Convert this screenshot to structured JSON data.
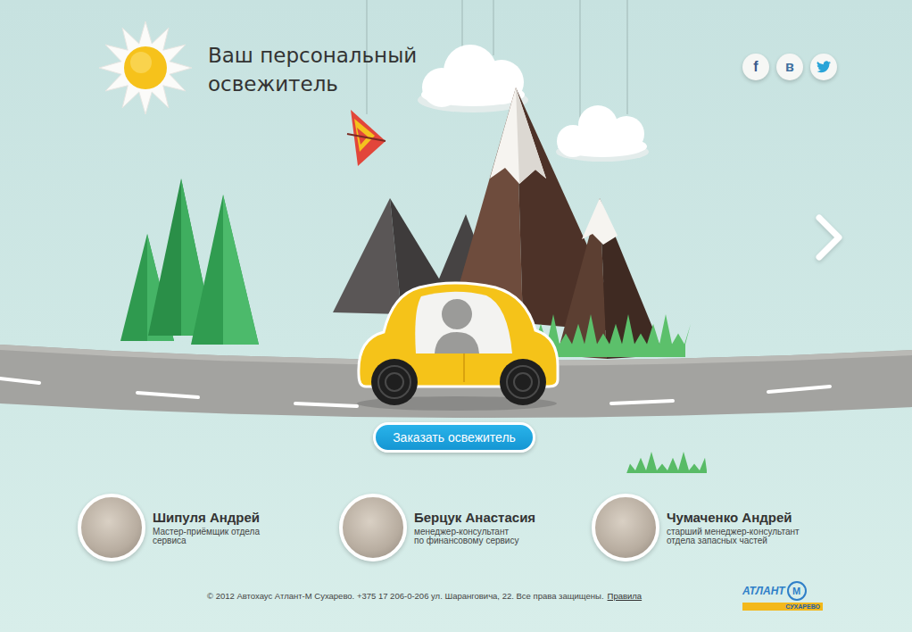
{
  "header": {
    "title_lines": [
      "Ваш персональный",
      "освежитель"
    ]
  },
  "social": [
    {
      "kind": "letter",
      "glyph": "f"
    },
    {
      "kind": "letter",
      "glyph": "в"
    },
    {
      "kind": "bird"
    }
  ],
  "order_button": "Заказать освежитель",
  "team": [
    {
      "name": "Шипуля Андрей",
      "role_lines": [
        "Мастер-приёмщик отдела",
        "сервиса"
      ]
    },
    {
      "name": "Берцук Анастасия",
      "role_lines": [
        "менеджер-консультант",
        "по финансовому сервису"
      ]
    },
    {
      "name": "Чумаченко Андрей",
      "role_lines": [
        "старший менеджер-консультант",
        "отдела запасных частей"
      ]
    }
  ],
  "footer": {
    "copyright": "© 2012 Автохаус Атлант-М Сухарево. +375 17 206-0-206 ул. Шаранговича, 22. Все права защищены.",
    "link": "Правила"
  },
  "logo": {
    "name": "АТЛАНТ",
    "mark": "М",
    "sub": "СУХАРЕВО"
  }
}
